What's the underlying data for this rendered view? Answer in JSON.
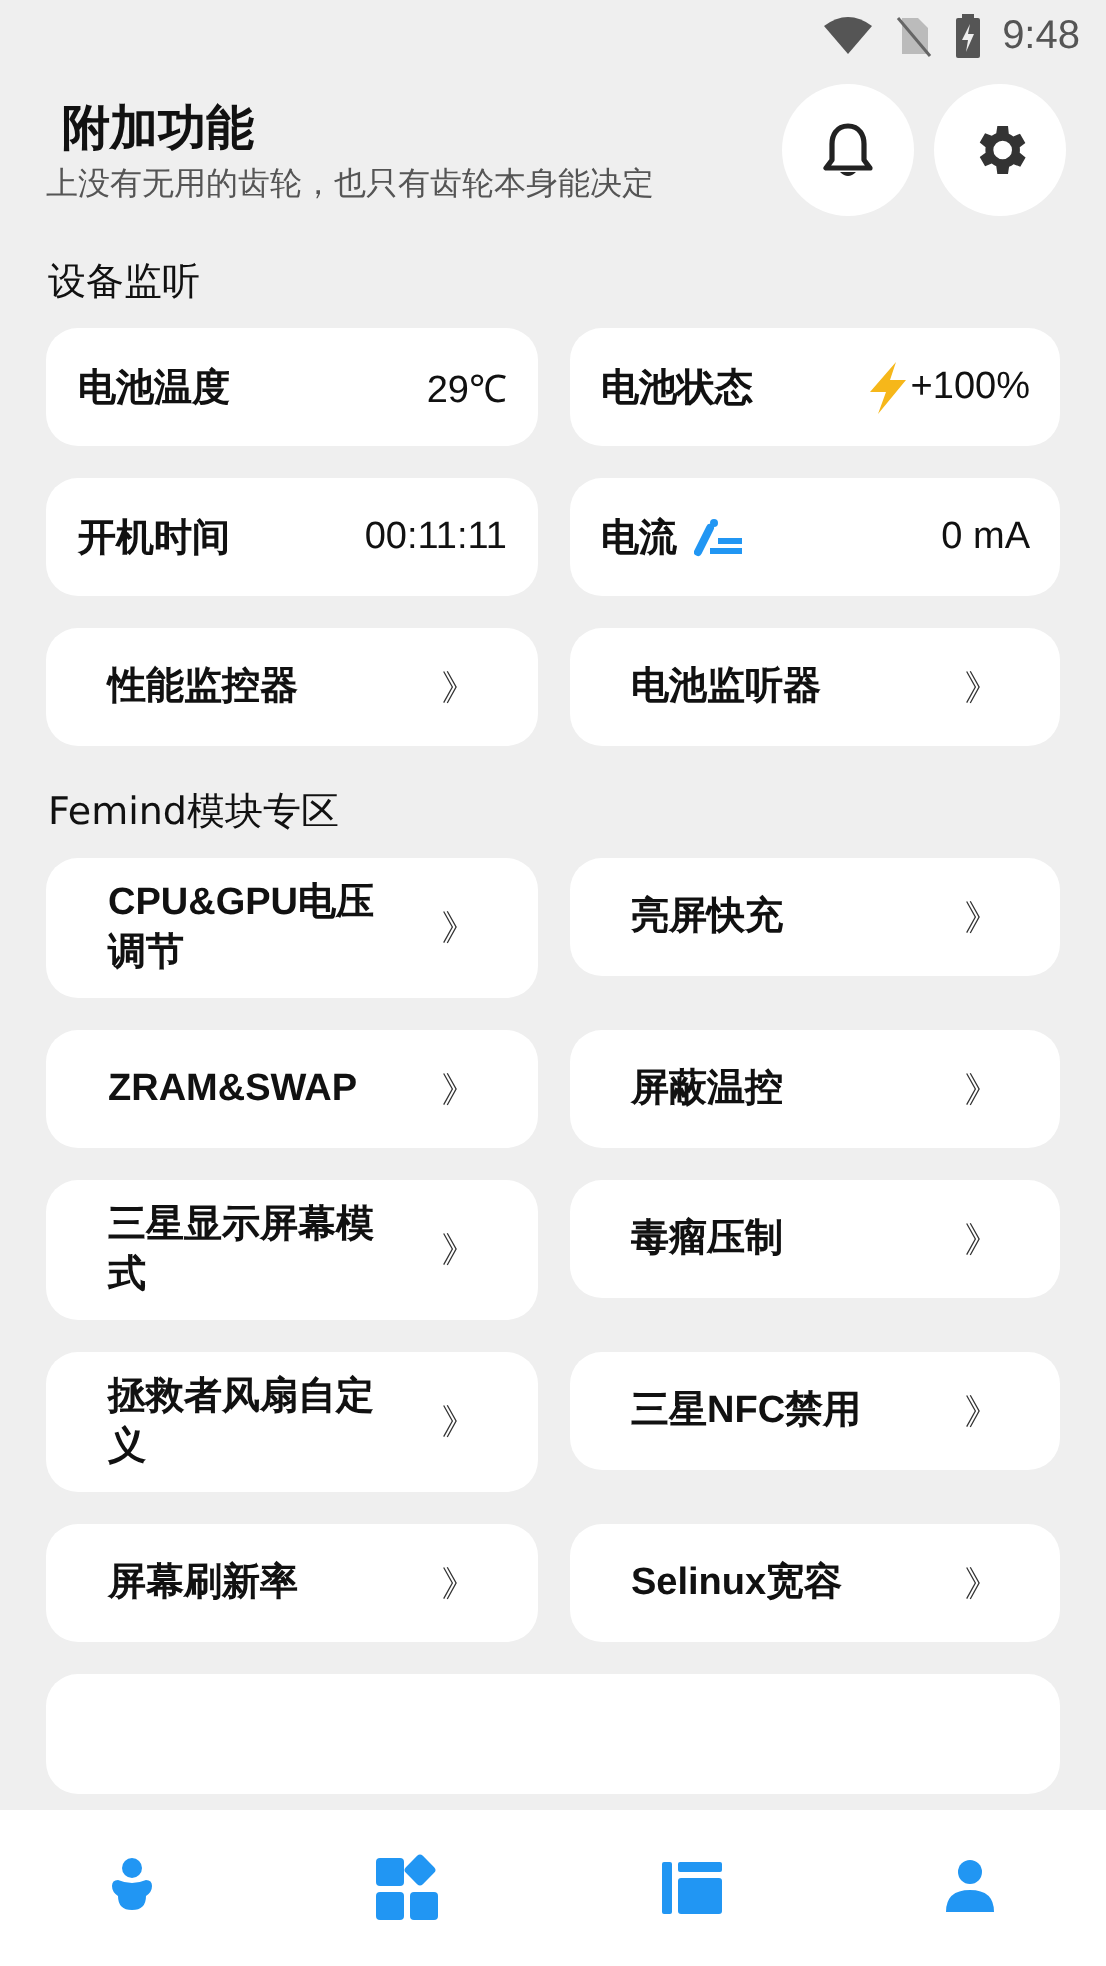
{
  "status_bar": {
    "time": "9:48"
  },
  "header": {
    "title": "附加功能",
    "subtitle": "上没有无用的齿轮，也只有齿轮本身能决定"
  },
  "sections": [
    {
      "title": "设备监听",
      "items": [
        {
          "kind": "info",
          "label": "电池温度",
          "value": "29℃"
        },
        {
          "kind": "info",
          "label": "电池状态",
          "value": "+100%",
          "charging": true
        },
        {
          "kind": "info",
          "label": "开机时间",
          "value": "00:11:11"
        },
        {
          "kind": "info",
          "label": "电流",
          "value": "0 mA",
          "current_icon": true
        },
        {
          "kind": "link",
          "label": "性能监控器",
          "chevron": "》"
        },
        {
          "kind": "link",
          "label": "电池监听器",
          "chevron": "》"
        }
      ]
    },
    {
      "title": "Femind模块专区",
      "items": [
        {
          "kind": "link",
          "label": "CPU&GPU电压调节",
          "chevron": "》"
        },
        {
          "kind": "link",
          "label": "亮屏快充",
          "chevron": "》"
        },
        {
          "kind": "link",
          "label": "ZRAM&SWAP",
          "chevron": "》"
        },
        {
          "kind": "link",
          "label": "屏蔽温控",
          "chevron": "》"
        },
        {
          "kind": "link",
          "label": "三星显示屏幕模式",
          "chevron": "》"
        },
        {
          "kind": "link",
          "label": "毒瘤压制",
          "chevron": "》"
        },
        {
          "kind": "link",
          "label": "拯救者风扇自定义",
          "chevron": "》"
        },
        {
          "kind": "link",
          "label": "三星NFC禁用",
          "chevron": "》"
        },
        {
          "kind": "link",
          "label": "屏幕刷新率",
          "chevron": "》"
        },
        {
          "kind": "link",
          "label": "Selinux宽容",
          "chevron": "》"
        }
      ]
    }
  ]
}
